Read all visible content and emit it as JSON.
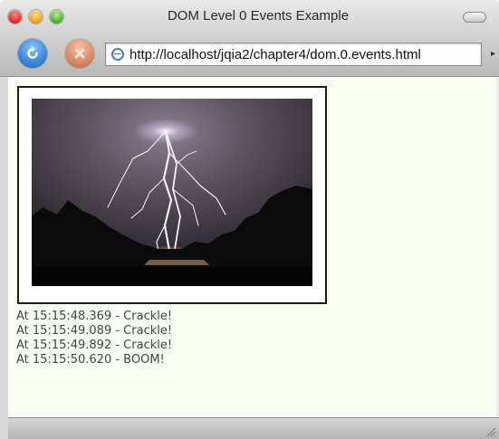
{
  "window": {
    "title": "DOM Level 0 Events Example"
  },
  "toolbar": {
    "url": "http://localhost/jqia2/chapter4/dom.0.events.html",
    "reload_icon": "reload-icon",
    "stop_icon": "stop-icon"
  },
  "content": {
    "image_subject": "lightning",
    "log": [
      "At 15:15:48.369 - Crackle!",
      "At 15:15:49.089 - Crackle!",
      "At 15:15:49.892 - Crackle!",
      "At 15:15:50.620 - BOOM!"
    ]
  },
  "colors": {
    "content_background": "#f9fff2",
    "log_text": "#444444"
  }
}
